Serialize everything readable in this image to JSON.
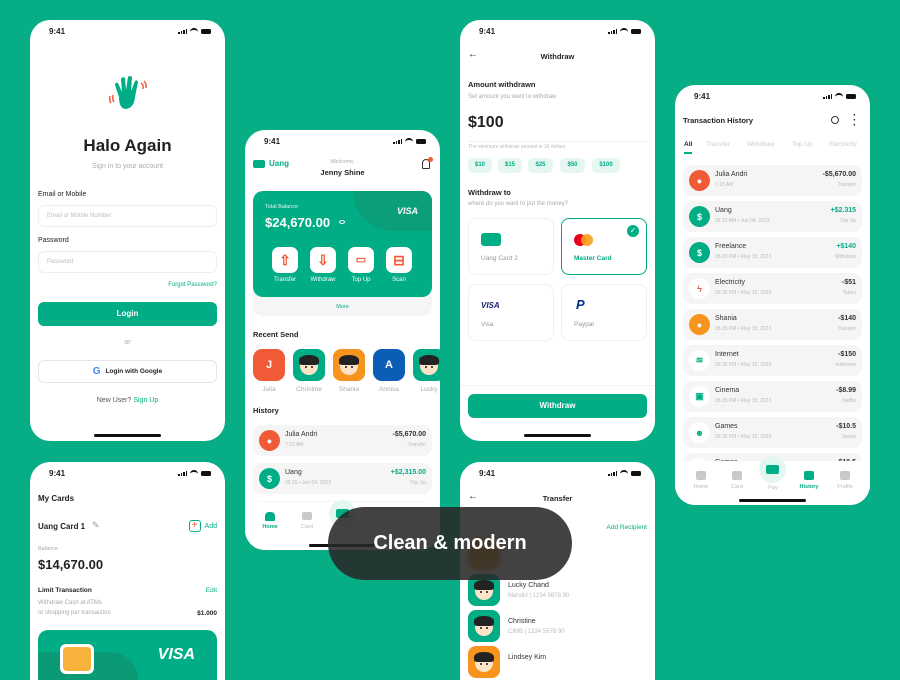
{
  "colors": {
    "background": "#07ad84",
    "accent": "#00ad85",
    "red": "#f05a37",
    "orange": "#f7941d",
    "blue": "#0b5db5"
  },
  "status": {
    "time": "9:41"
  },
  "login": {
    "title": "Halo Again",
    "subtitle": "Sign in to your account",
    "email_label": "Email or Mobile",
    "email_placeholder": "Email or Mobile Number",
    "password_label": "Password",
    "password_placeholder": "Password",
    "forgot": "Forgot Password?",
    "login_btn": "Login",
    "or": "or",
    "google_btn": "Login with Google",
    "new_user": "New User?",
    "sign_up": "Sign Up"
  },
  "cards": {
    "title": "My Cards",
    "card_name": "Uang Card 1",
    "add": "Add",
    "balance_label": "Balance",
    "balance": "$14,670.00",
    "limit_title": "Limit Transaction",
    "edit": "Edit",
    "limit_desc1": "Withdraw Cash at ATMs",
    "limit_desc2": "or shopping per transaction",
    "limit_value": "$1.000",
    "card_brand": "VISA"
  },
  "home": {
    "logo": "Uang",
    "welcome": "Welcome,",
    "user": "Jenny Shine",
    "balance_label": "Total Balance",
    "balance": "$24,670.00",
    "card_brand": "VISA",
    "actions": [
      {
        "label": "Transfer",
        "icon": "upload-icon"
      },
      {
        "label": "Withdraw",
        "icon": "download-icon"
      },
      {
        "label": "Top Up",
        "icon": "card-plus-icon"
      },
      {
        "label": "Scan",
        "icon": "scan-icon"
      }
    ],
    "more": "More",
    "recent_title": "Recent Send",
    "recent": [
      {
        "name": "Julia",
        "initial": "J",
        "color": "#f05a37"
      },
      {
        "name": "Christine",
        "color": "#00ad85"
      },
      {
        "name": "Shania",
        "color": "#f7941d"
      },
      {
        "name": "Annisa",
        "initial": "A",
        "color": "#0b5db5"
      },
      {
        "name": "Lucky",
        "color": "#00ad85"
      }
    ],
    "history_title": "History",
    "history": [
      {
        "name": "Julia Andri",
        "sub": "7.15 AM",
        "amount": "-$5,670.00",
        "category": "Transfer",
        "icon": "person",
        "color": "#f05a37"
      },
      {
        "name": "Uang",
        "sub": "09.15  •  Jun 04, 2023",
        "amount": "+$2,315.00",
        "category": "Top Up",
        "icon": "dollar",
        "color": "#00ad85",
        "positive": true
      },
      {
        "name": "Freelance",
        "sub": "",
        "amount": "",
        "category": "",
        "icon": "dollar",
        "color": "#00ad85",
        "positive": true
      }
    ],
    "nav": [
      {
        "label": "Home",
        "active": true
      },
      {
        "label": "Card"
      }
    ]
  },
  "withdraw": {
    "title": "Withdraw",
    "amount_title": "Amount withdrawn",
    "amount_sub": "Set amount you want to withdraw",
    "amount": "$100",
    "min_note": "The minimum withdraw amount is 10 dollars",
    "chips": [
      "$10",
      "$15",
      "$25",
      "$50",
      "$100"
    ],
    "to_title": "Withdraw to",
    "to_sub": "where do you want to put the money?",
    "methods": [
      {
        "label": "Uang Card 2"
      },
      {
        "label": "Master Card",
        "selected": true
      },
      {
        "label": "Visa",
        "logo": "VISA"
      },
      {
        "label": "Paypal",
        "logo": "P"
      }
    ],
    "button": "Withdraw"
  },
  "transfer": {
    "title": "Transfer",
    "add_recipient": "Add Recipient",
    "recipients": [
      {
        "name": "Lucky Chand",
        "sub": "Mandiri | 1234 5678 90",
        "color": "#00ad85"
      },
      {
        "name": "Christine",
        "sub": "CIMB | 1234 5678 90",
        "color": "#00ad85"
      },
      {
        "name": "Lindsey Kim",
        "sub": "",
        "color": "#f7941d"
      }
    ]
  },
  "history": {
    "title": "Transaction History",
    "tabs": [
      "All",
      "Transfer",
      "Withdraw",
      "Top Up",
      "Electricity"
    ],
    "active_tab": "All",
    "rows": [
      {
        "name": "Julia Andri",
        "sub": "7.15 AM",
        "amount": "-$5,670.00",
        "category": "Transfer",
        "icon": "person",
        "color": "#f05a37"
      },
      {
        "name": "Uang",
        "sub": "09.15 AM  •  Jun 04, 2023",
        "amount": "+$2.315",
        "category": "Top Up",
        "icon": "dollar",
        "color": "#00ad85",
        "positive": true
      },
      {
        "name": "Freelance",
        "sub": "05.20 PM  •  May 15, 2023",
        "amount": "+$140",
        "category": "Withdraw",
        "icon": "dollar",
        "color": "#00ad85",
        "positive": true
      },
      {
        "name": "Electricity",
        "sub": "05.35 PM  •  May 15, 2023",
        "amount": "-$51",
        "category": "Token",
        "icon": "bolt",
        "color": "#ffffff"
      },
      {
        "name": "Shania",
        "sub": "05.35 PM  •  May 15, 2023",
        "amount": "-$140",
        "category": "Transfer",
        "icon": "person",
        "color": "#f7941d"
      },
      {
        "name": "Internet",
        "sub": "05.35 PM  •  May 15, 2023",
        "amount": "-$150",
        "category": "Indihome",
        "icon": "wifi",
        "color": "#ffffff"
      },
      {
        "name": "Cinema",
        "sub": "05.35 PM  •  May 15, 2023",
        "amount": "-$8.99",
        "category": "Netflix",
        "icon": "tv",
        "color": "#ffffff"
      },
      {
        "name": "Games",
        "sub": "05.35 PM  •  May 15, 2023",
        "amount": "-$10.5",
        "category": "Steam",
        "icon": "game",
        "color": "#ffffff"
      },
      {
        "name": "Games",
        "sub": "",
        "amount": "-$10.5",
        "category": "",
        "icon": "chart",
        "color": "#ffffff"
      }
    ],
    "nav": [
      {
        "label": "Home"
      },
      {
        "label": "Card"
      },
      {
        "label": "Pay"
      },
      {
        "label": "History",
        "active": true
      },
      {
        "label": "Profile"
      }
    ]
  },
  "overlay": {
    "text": "Clean & modern"
  }
}
